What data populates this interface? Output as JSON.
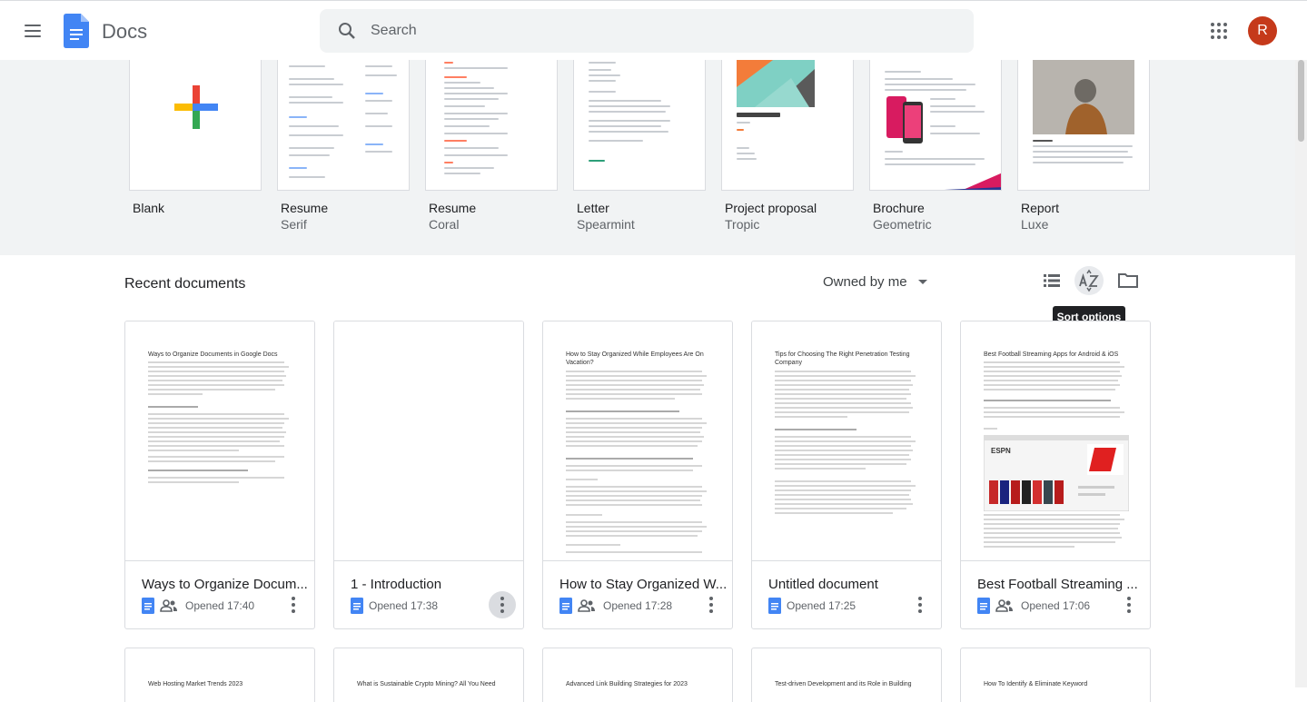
{
  "header": {
    "app_title": "Docs",
    "search_placeholder": "Search",
    "avatar_initial": "R"
  },
  "templates": [
    {
      "name": "Blank",
      "sub": ""
    },
    {
      "name": "Resume",
      "sub": "Serif"
    },
    {
      "name": "Resume",
      "sub": "Coral"
    },
    {
      "name": "Letter",
      "sub": "Spearmint"
    },
    {
      "name": "Project proposal",
      "sub": "Tropic"
    },
    {
      "name": "Brochure",
      "sub": "Geometric"
    },
    {
      "name": "Report",
      "sub": "Luxe"
    }
  ],
  "recent": {
    "title": "Recent documents",
    "owner_filter": "Owned by me",
    "tooltip": "Sort options",
    "documents": [
      {
        "title": "Ways to Organize Docum...",
        "opened": "Opened 17:40",
        "shared": true,
        "preview": "Ways to Organize Documents in Google Docs"
      },
      {
        "title": "1 - Introduction",
        "opened": "Opened 17:38",
        "shared": false,
        "preview": ""
      },
      {
        "title": "How to Stay Organized W...",
        "opened": "Opened 17:28",
        "shared": true,
        "preview": "How to Stay Organized While Employees Are On Vacation?"
      },
      {
        "title": "Untitled document",
        "opened": "Opened 17:25",
        "shared": false,
        "preview": "Tips for Choosing The Right Penetration Testing Company"
      },
      {
        "title": "Best Football Streaming ...",
        "opened": "Opened 17:06",
        "shared": true,
        "preview": "Best Football Streaming Apps for Android & iOS"
      }
    ],
    "documents_row2": [
      {
        "preview": "Web Hosting Market Trends 2023"
      },
      {
        "preview": "What is Sustainable Crypto Mining? All You Need"
      },
      {
        "preview": "Advanced Link Building Strategies for 2023"
      },
      {
        "preview": "Test-driven Development and its Role in Building"
      },
      {
        "preview": "How To Identify & Eliminate Keyword"
      }
    ]
  },
  "colors": {
    "accent": "#4285f4",
    "avatar": "#c5391a",
    "gallery_bg": "#f1f3f4"
  }
}
